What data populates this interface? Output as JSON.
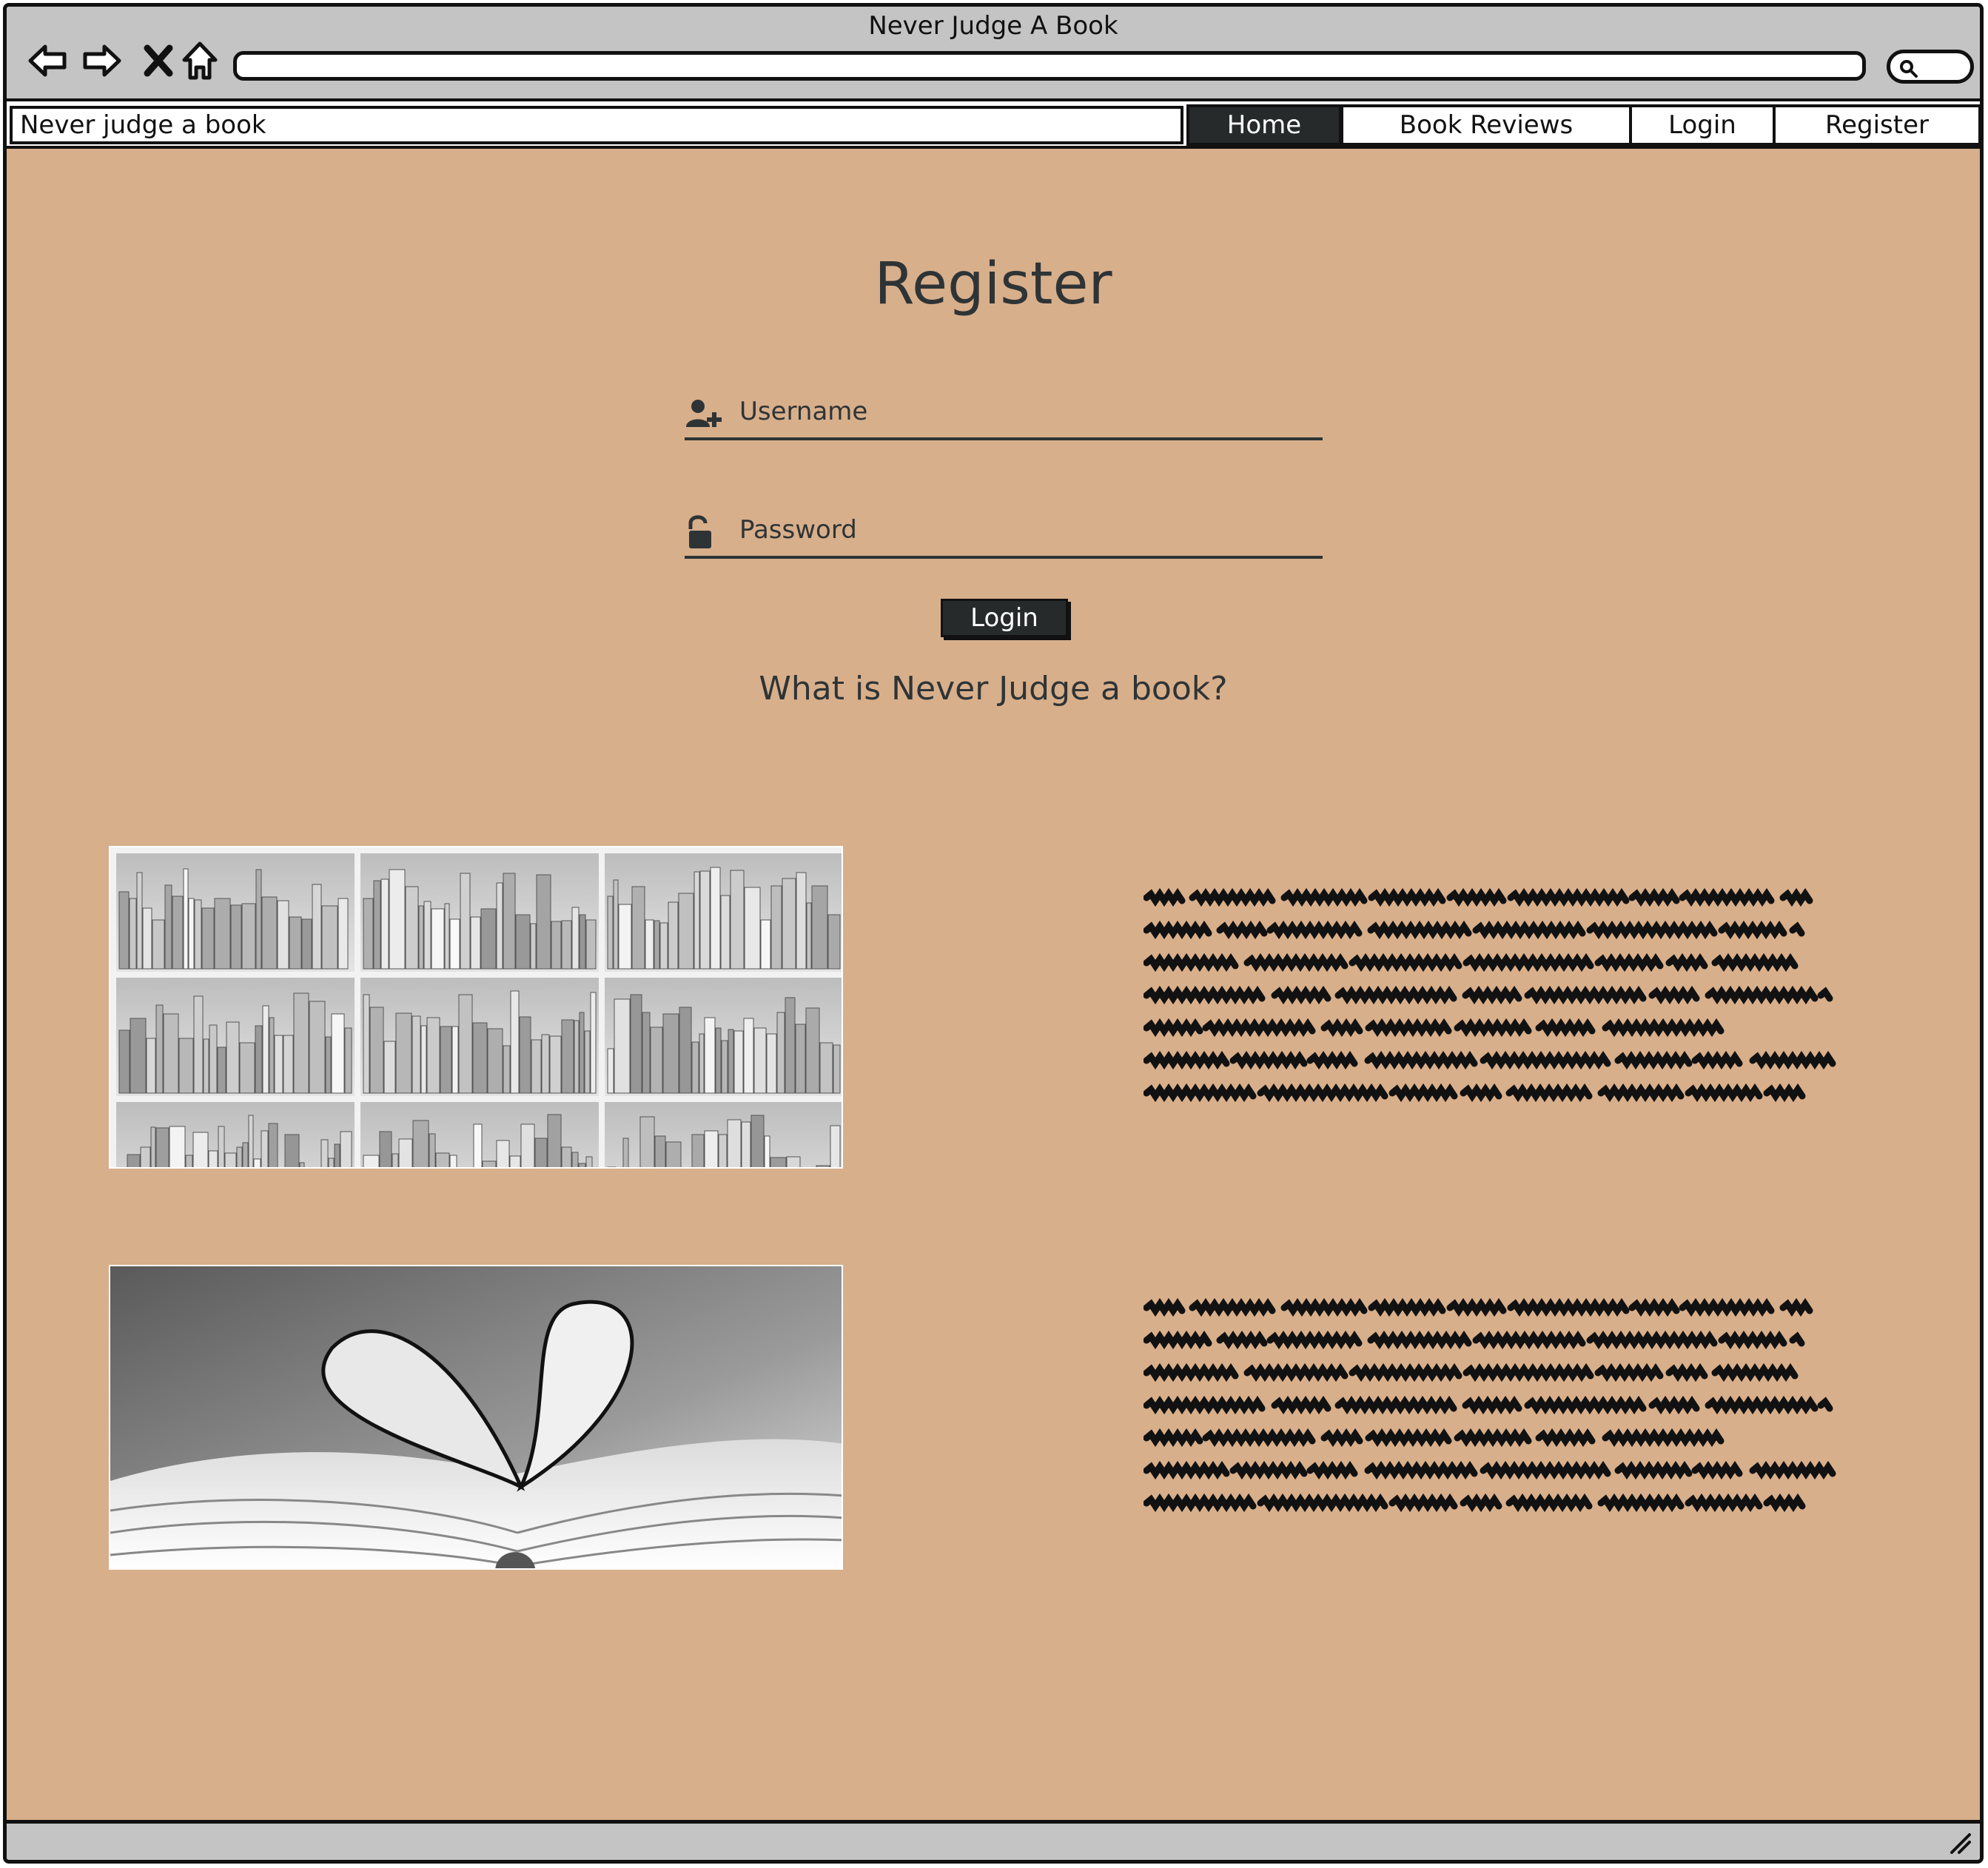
{
  "window": {
    "title": "Never Judge A Book"
  },
  "toolbar": {
    "back_icon": "back-arrow-icon",
    "forward_icon": "forward-arrow-icon",
    "stop_icon": "close-icon",
    "home_icon": "home-icon",
    "address_value": "",
    "search_icon": "search-icon"
  },
  "menubar": {
    "brand": "Never judge a book",
    "items": [
      {
        "label": "Home",
        "active": true
      },
      {
        "label": "Book Reviews",
        "active": false
      },
      {
        "label": "Login",
        "active": false
      },
      {
        "label": "Register",
        "active": false
      }
    ]
  },
  "form": {
    "title": "Register",
    "username": {
      "placeholder": "Username",
      "value": "",
      "icon": "add-user-icon"
    },
    "password": {
      "placeholder": "Password",
      "value": "",
      "icon": "unlock-icon"
    },
    "submit_label": "Login"
  },
  "about": {
    "heading": "What is Never Judge a book?",
    "sections": [
      {
        "image": "bookshelf-photo",
        "text_icon": "placeholder-text-scribble"
      },
      {
        "image": "heart-pages-photo",
        "text_icon": "placeholder-text-scribble"
      }
    ]
  },
  "colors": {
    "page_background": "#d8af8b",
    "chrome": "#c4c4c4",
    "active_tab": "#262a2b",
    "text": "#2e3436"
  }
}
